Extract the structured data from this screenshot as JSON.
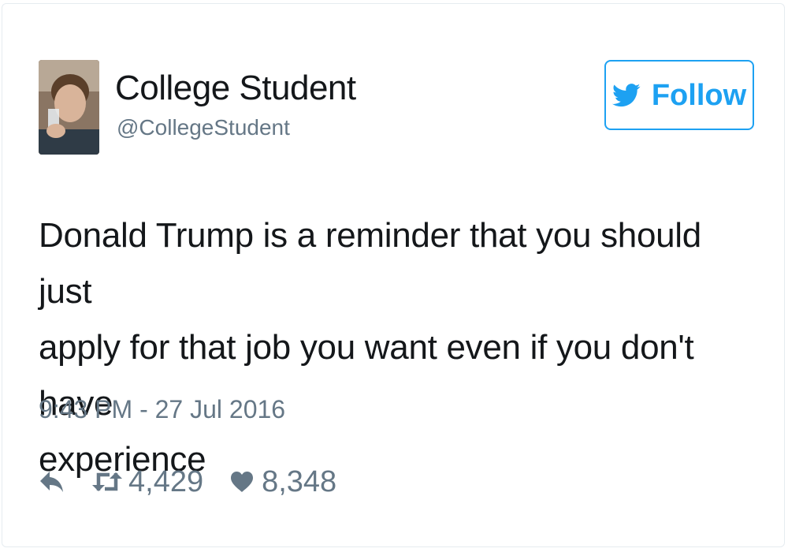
{
  "tweet": {
    "author": {
      "display_name": "College Student",
      "handle": "@CollegeStudent",
      "avatar_icon": "user-photo-avatar"
    },
    "follow_button": {
      "label": "Follow",
      "icon": "twitter-bird-icon"
    },
    "text": "Donald Trump is a reminder that you should just\napply for that job you want even if you don't have\nexperience",
    "timestamp": "9:43 PM - 27 Jul 2016",
    "actions": {
      "reply_icon": "reply-icon",
      "retweet_icon": "retweet-icon",
      "retweet_count": "4,429",
      "like_icon": "heart-icon",
      "like_count": "8,348"
    }
  },
  "colors": {
    "accent": "#1da1f2",
    "text_primary": "#14171a",
    "text_secondary": "#657786",
    "border": "#e6ecf0"
  }
}
